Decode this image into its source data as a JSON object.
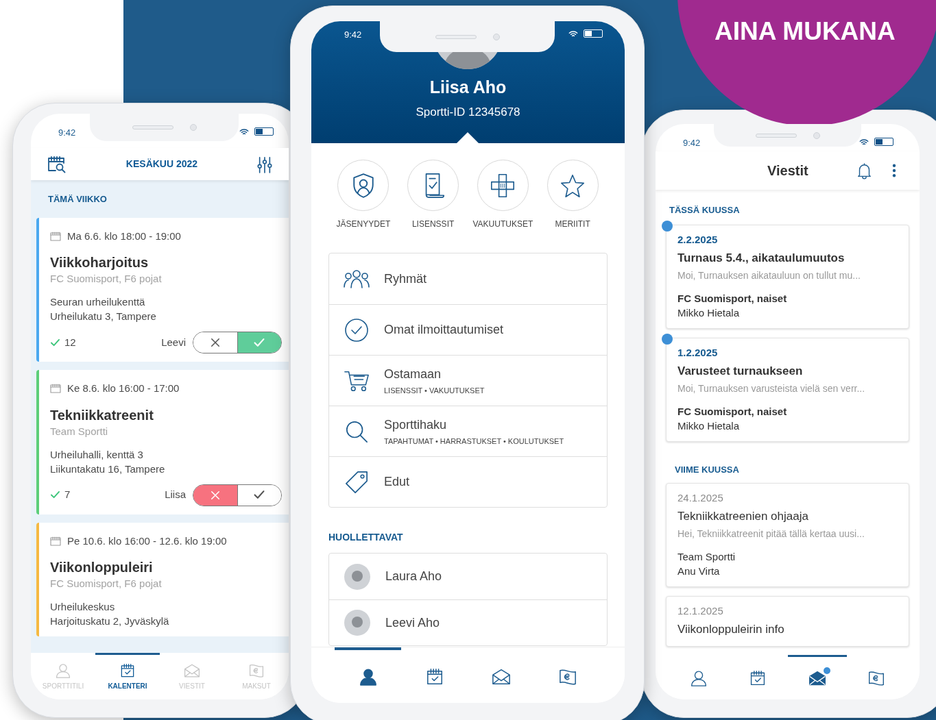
{
  "banner": {
    "text": "AINA MUKANA"
  },
  "calendar_phone": {
    "time": "9:42",
    "title": "KESÄKUU 2022",
    "section": "TÄMÄ VIIKKO",
    "events": [
      {
        "date": "Ma 6.6. klo 18:00 - 19:00",
        "title": "Viikkoharjoitus",
        "team": "FC Suomisport, F6 pojat",
        "place": "Seuran urheilukenttä",
        "address": "Urheilukatu 3, Tampere",
        "count": "12",
        "person": "Leevi",
        "going": true,
        "color": "#4aa8f0"
      },
      {
        "date": "Ke 8.6. klo 16:00 - 17:00",
        "title": "Tekniikkatreenit",
        "team": "Team Sportti",
        "place": "Urheiluhalli, kenttä 3",
        "address": "Liikuntakatu 16, Tampere",
        "count": "7",
        "person": "Liisa",
        "going": false,
        "color": "#5ccf7a"
      },
      {
        "date": "Pe 10.6. klo 16:00 - 12.6. klo 19:00",
        "title": "Viikonloppuleiri",
        "team": "FC Suomisport, F6 pojat",
        "place": "Urheilukeskus",
        "address": "Harjoituskatu 2, Jyväskylä",
        "color": "#f5b942"
      }
    ],
    "tabs": [
      {
        "label": "SPORTTITILI",
        "selected": false
      },
      {
        "label": "KALENTERI",
        "selected": true
      },
      {
        "label": "VIESTIT",
        "selected": false
      },
      {
        "label": "MAKSUT",
        "selected": false
      }
    ]
  },
  "profile_phone": {
    "time": "9:42",
    "name": "Liisa Aho",
    "id": "Sportti-ID 12345678",
    "shortcuts": [
      "JÄSENYYDET",
      "LISENSSIT",
      "VAKUUTUKSET",
      "MERIITIT"
    ],
    "menu": [
      {
        "title": "Ryhmät"
      },
      {
        "title": "Omat ilmoittautumiset"
      },
      {
        "title": "Ostamaan",
        "subtitle": "LISENSSIT • VAKUUTUKSET"
      },
      {
        "title": "Sporttihaku",
        "subtitle": "TAPAHTUMAT • HARRASTUKSET • KOULUTUKSET"
      },
      {
        "title": "Edut"
      }
    ],
    "dependants_title": "HUOLLETTAVAT",
    "dependants": [
      "Laura Aho",
      "Leevi Aho"
    ],
    "tabs": [
      {
        "selected": true
      },
      {
        "selected": false
      },
      {
        "selected": false
      },
      {
        "selected": false
      }
    ]
  },
  "messages_phone": {
    "time": "9:42",
    "title": "Viestit",
    "sections": [
      {
        "title": "TÄSSÄ KUUSSA",
        "messages": [
          {
            "date": "2.2.2025",
            "title": "Turnaus 5.4., aikataulumuutos",
            "preview": "Moi, Turnauksen aikatauluun on tullut mu...",
            "sender": "FC Suomisport, naiset",
            "author": "Mikko Hietala",
            "unread": true
          },
          {
            "date": "1.2.2025",
            "title": "Varusteet turnaukseen",
            "preview": "Moi, Turnauksen varusteista vielä sen verr...",
            "sender": "FC Suomisport, naiset",
            "author": "Mikko Hietala",
            "unread": true
          }
        ]
      },
      {
        "title": "VIIME KUUSSA",
        "messages": [
          {
            "date": "24.1.2025",
            "title": "Tekniikkatreenien ohjaaja",
            "preview": "Hei, Tekniikkatreenit pitää tällä kertaa uusi...",
            "sender": "Team Sportti",
            "author": "Anu Virta",
            "unread": false
          },
          {
            "date": "12.1.2025",
            "title": "Viikonloppuleirin info",
            "unread": false
          }
        ]
      }
    ],
    "tabs": [
      {
        "selected": false,
        "unread": false
      },
      {
        "selected": false,
        "unread": false
      },
      {
        "selected": true,
        "unread": true
      },
      {
        "selected": false,
        "unread": false
      }
    ]
  }
}
